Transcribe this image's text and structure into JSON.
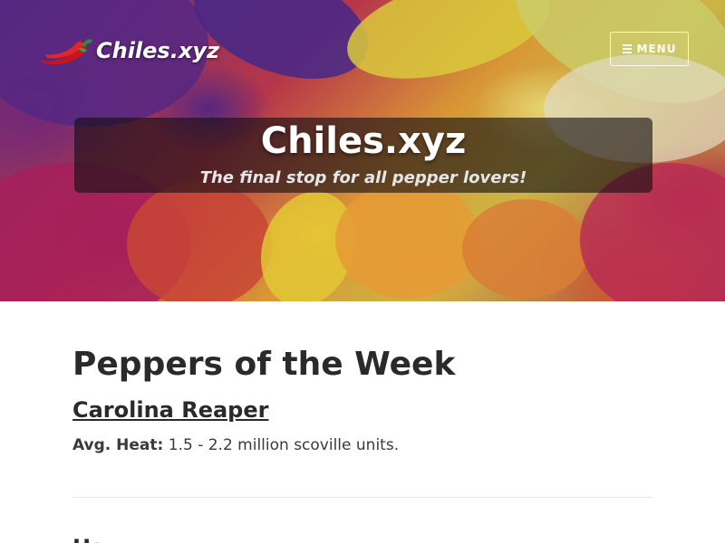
{
  "header": {
    "brand_name": "Chiles.xyz",
    "brand_icon": "chili-pepper-icon",
    "menu_label": "MENU",
    "menu_icon": "hamburger-icon"
  },
  "hero": {
    "title": "Chiles.xyz",
    "tagline": "The final stop for all pepper lovers!"
  },
  "main": {
    "section_title": "Peppers of the Week",
    "featured": [
      {
        "name": "Carolina Reaper",
        "heat_label": "Avg. Heat:",
        "heat_value": "1.5 - 2.2 million scoville units."
      }
    ],
    "next_title": "Ha"
  },
  "colors": {
    "accent_red": "#c4161c",
    "text_dark": "#2a2a2a",
    "panel": "rgba(20,15,20,0.62)"
  }
}
